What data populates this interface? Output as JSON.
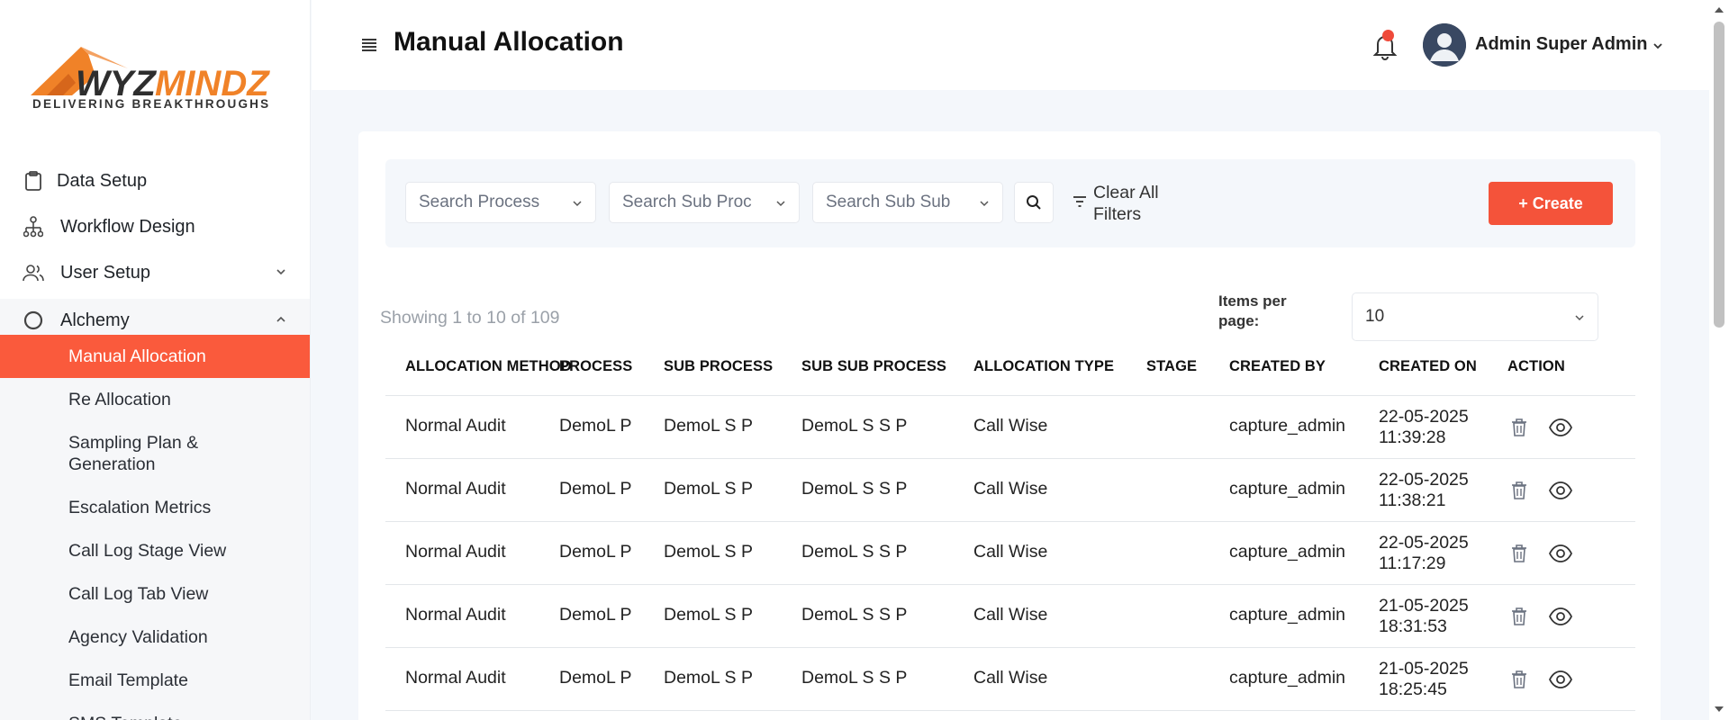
{
  "brand": {
    "logo_text_a": "WYZ",
    "logo_text_b": "MINDZ",
    "tagline": "DELIVERING  BREAKTHROUGHS",
    "primary_color": "#f4533a",
    "logo_orange": "#f08228"
  },
  "sidebar": {
    "items": [
      {
        "label": "Data Setup",
        "icon": "clipboard-icon"
      },
      {
        "label": "Workflow Design",
        "icon": "hierarchy-icon"
      },
      {
        "label": "User Setup",
        "icon": "users-icon"
      },
      {
        "label": "Alchemy",
        "icon": "circle-icon"
      }
    ],
    "sub_items": [
      {
        "label": "Manual Allocation",
        "active": true
      },
      {
        "label": "Re Allocation"
      },
      {
        "label": "Sampling Plan & Generation"
      },
      {
        "label": "Escalation Metrics"
      },
      {
        "label": "Call Log Stage View"
      },
      {
        "label": "Call Log Tab View"
      },
      {
        "label": "Agency Validation"
      },
      {
        "label": "Email Template"
      },
      {
        "label": "SMS Template"
      }
    ]
  },
  "header": {
    "title": "Manual Allocation",
    "user_name": "Admin Super Admin"
  },
  "filters": {
    "process_placeholder": "Search Process",
    "sub_process_placeholder": "Search Sub Proc",
    "sub_sub_process_placeholder": "Search Sub Sub",
    "clear_label": "Clear All Filters",
    "create_label": "+ Create"
  },
  "pagination": {
    "showing": "Showing 1 to 10 of 109",
    "items_per_page_label": "Items per page:",
    "items_per_page_value": "10"
  },
  "table": {
    "columns": [
      "ALLOCATION METHOD",
      "PROCESS",
      "SUB PROCESS",
      "SUB SUB PROCESS",
      "ALLOCATION TYPE",
      "STAGE",
      "CREATED BY",
      "CREATED ON",
      "ACTION"
    ],
    "rows": [
      {
        "method": "Normal Audit",
        "process": "DemoL P",
        "sub_process": "DemoL S P",
        "sub_sub_process": "DemoL S S P",
        "type": "Call Wise",
        "stage": "",
        "created_by": "capture_admin",
        "date": "22-05-2025",
        "time": "11:39:28"
      },
      {
        "method": "Normal Audit",
        "process": "DemoL P",
        "sub_process": "DemoL S P",
        "sub_sub_process": "DemoL S S P",
        "type": "Call Wise",
        "stage": "",
        "created_by": "capture_admin",
        "date": "22-05-2025",
        "time": "11:38:21"
      },
      {
        "method": "Normal Audit",
        "process": "DemoL P",
        "sub_process": "DemoL S P",
        "sub_sub_process": "DemoL S S P",
        "type": "Call Wise",
        "stage": "",
        "created_by": "capture_admin",
        "date": "22-05-2025",
        "time": "11:17:29"
      },
      {
        "method": "Normal Audit",
        "process": "DemoL P",
        "sub_process": "DemoL S P",
        "sub_sub_process": "DemoL S S P",
        "type": "Call Wise",
        "stage": "",
        "created_by": "capture_admin",
        "date": "21-05-2025",
        "time": "18:31:53"
      },
      {
        "method": "Normal Audit",
        "process": "DemoL P",
        "sub_process": "DemoL S P",
        "sub_sub_process": "DemoL S S P",
        "type": "Call Wise",
        "stage": "",
        "created_by": "capture_admin",
        "date": "21-05-2025",
        "time": "18:25:45"
      }
    ]
  }
}
